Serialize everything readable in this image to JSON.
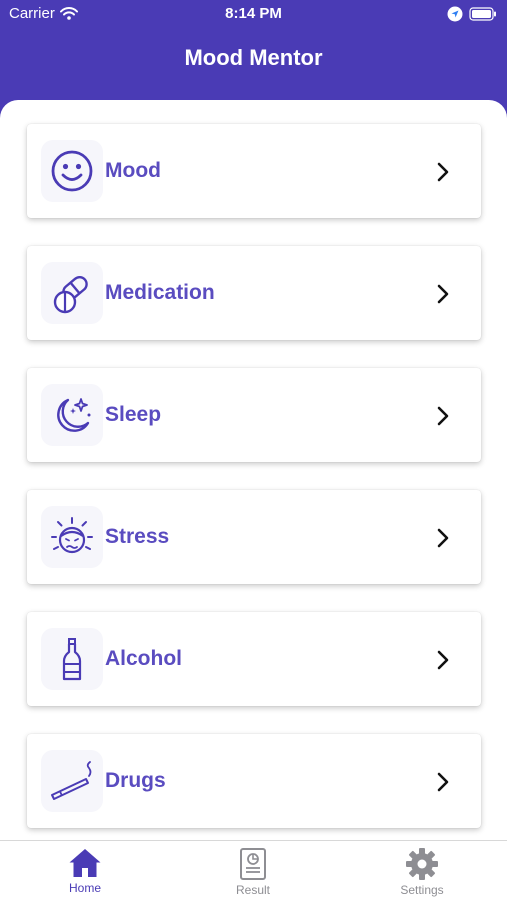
{
  "status_bar": {
    "carrier": "Carrier",
    "time": "8:14 PM"
  },
  "header": {
    "title": "Mood Mentor"
  },
  "menu": {
    "items": [
      {
        "label": "Mood",
        "icon": "smiley-icon"
      },
      {
        "label": "Medication",
        "icon": "pills-icon"
      },
      {
        "label": "Sleep",
        "icon": "moon-stars-icon"
      },
      {
        "label": "Stress",
        "icon": "stressed-face-icon"
      },
      {
        "label": "Alcohol",
        "icon": "bottle-icon"
      },
      {
        "label": "Drugs",
        "icon": "joint-icon"
      }
    ]
  },
  "tab_bar": {
    "tabs": [
      {
        "label": "Home",
        "icon": "home-icon",
        "active": true
      },
      {
        "label": "Result",
        "icon": "report-icon",
        "active": false
      },
      {
        "label": "Settings",
        "icon": "gear-icon",
        "active": false
      }
    ]
  },
  "colors": {
    "primary": "#4a3bb5",
    "accent": "#5a4cc0",
    "inactive": "#8e8e93"
  }
}
